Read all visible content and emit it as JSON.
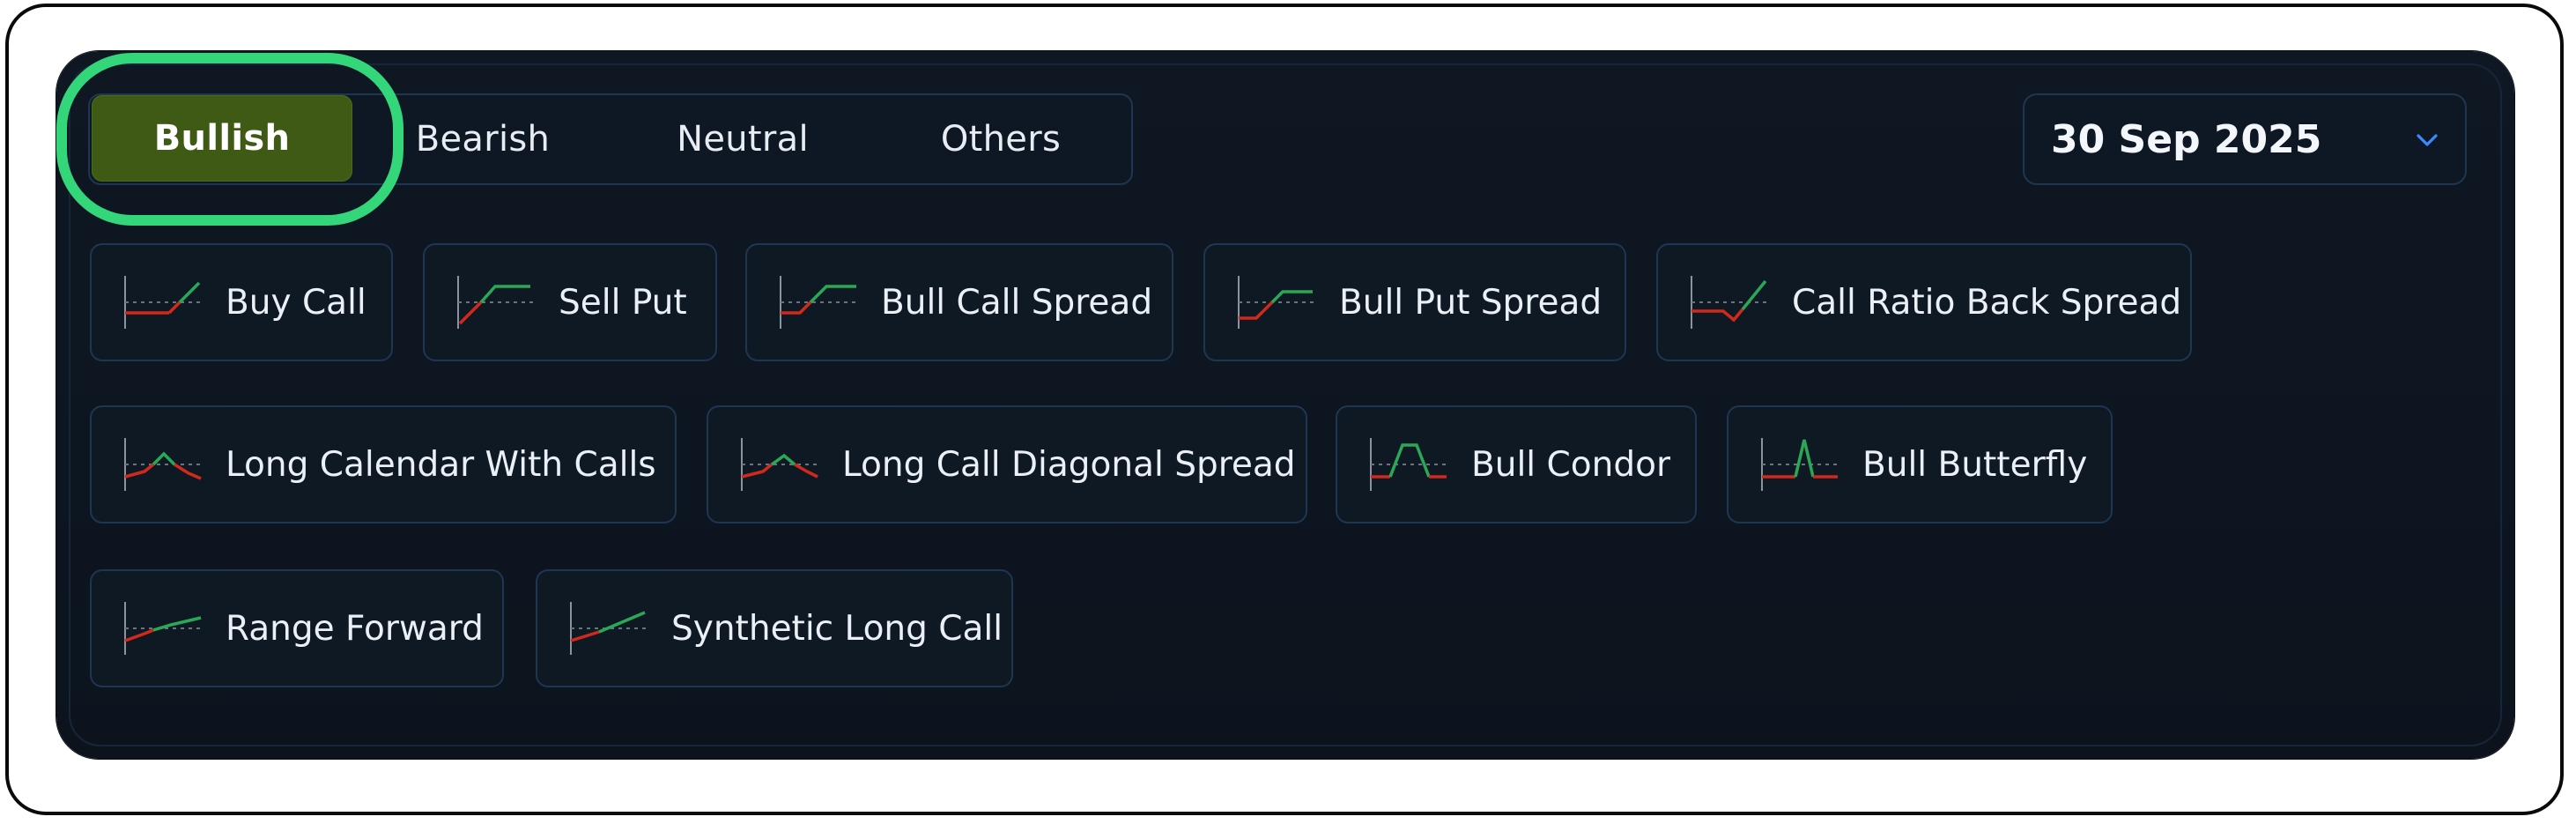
{
  "tabs": {
    "bullish": "Bullish",
    "bearish": "Bearish",
    "neutral": "Neutral",
    "others": "Others"
  },
  "date_select": {
    "value": "30 Sep 2025",
    "icon": "chevron-down-icon"
  },
  "strategies": {
    "buy_call": "Buy Call",
    "sell_put": "Sell Put",
    "bull_call_spread": "Bull Call Spread",
    "bull_put_spread": "Bull Put Spread",
    "call_ratio_back_spread": "Call Ratio Back Spread",
    "long_calendar_with_calls": "Long Calendar With Calls",
    "long_call_diagonal_spread": "Long Call Diagonal Spread",
    "bull_condor": "Bull Condor",
    "bull_butterfly": "Bull Butterfly",
    "range_forward": "Range Forward",
    "synthetic_long_call": "Synthetic Long Call"
  },
  "colors": {
    "active_tab": "#3e5a15",
    "highlight": "#34d67a",
    "payoff_loss": "#d1291b",
    "payoff_profit": "#2aa855",
    "chevron": "#3a8bff"
  }
}
